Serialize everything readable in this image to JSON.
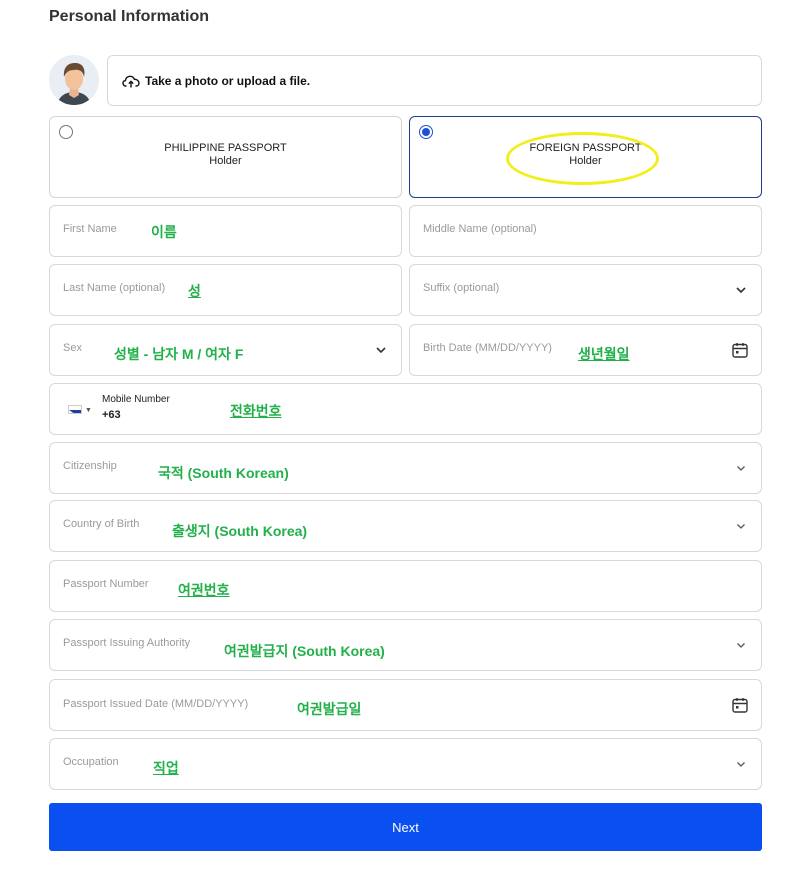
{
  "title": "Personal Information",
  "upload": {
    "label": "Take a photo or upload a file."
  },
  "passport_options": [
    {
      "line1": "PHILIPPINE PASSPORT",
      "line2": "Holder",
      "selected": false
    },
    {
      "line1": "FOREIGN PASSPORT",
      "line2": "Holder",
      "selected": true
    }
  ],
  "fields": {
    "first_name": {
      "label": "First Name",
      "note": "이름"
    },
    "middle_name": {
      "label": "Middle Name (optional)"
    },
    "last_name": {
      "label": "Last Name (optional)",
      "note": "성"
    },
    "suffix": {
      "label": "Suffix (optional)"
    },
    "sex": {
      "label": "Sex",
      "note": "성별 - 남자 M / 여자 F"
    },
    "birth_date": {
      "label": "Birth Date (MM/DD/YYYY)",
      "note": "생년월일"
    },
    "mobile": {
      "label": "Mobile Number",
      "code": "+63",
      "note": "전화번호"
    },
    "citizenship": {
      "label": "Citizenship",
      "note": "국적 (South Korean)"
    },
    "country_of_birth": {
      "label": "Country of Birth",
      "note": "출생지 (South Korea)"
    },
    "passport_number": {
      "label": "Passport Number",
      "note": "여권번호"
    },
    "passport_authority": {
      "label": "Passport Issuing Authority",
      "note": "여권발급지 (South Korea)"
    },
    "passport_issued_date": {
      "label": "Passport Issued Date (MM/DD/YYYY)",
      "note": "여권발급일"
    },
    "occupation": {
      "label": "Occupation",
      "note": "직업"
    }
  },
  "next_button": {
    "label": "Next"
  },
  "colors": {
    "accent": "#0a4ff0",
    "annotation": "#22b04a",
    "highlight": "#f2ee1c"
  },
  "icons": [
    "upload-cloud-icon",
    "chevron-down-icon",
    "calendar-icon",
    "philippines-flag-icon"
  ]
}
